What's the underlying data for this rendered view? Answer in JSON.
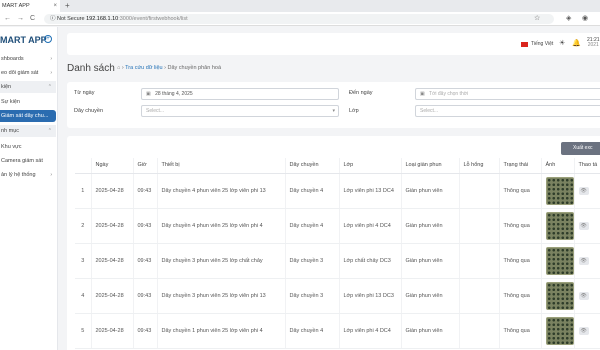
{
  "browser": {
    "tab_title": "MART APP",
    "tab_close": "×",
    "new_tab": "+",
    "back": "←",
    "forward": "→",
    "reload": "C",
    "info": "ⓘ",
    "not_secure": "Not Secure",
    "host": "192.168.1.10",
    "path": ":3000/event/firstwebhook/list",
    "star": "☆"
  },
  "sidebar": {
    "brand": "MART APP",
    "brand_icon": "plus-circle-icon",
    "items": [
      {
        "label": "shboards",
        "chev": "›"
      },
      {
        "label": "eo dõi giám sát",
        "chev": "›"
      },
      {
        "label": "kiện",
        "chev": "⌃"
      },
      {
        "label": "Sự kiện",
        "chev": ""
      },
      {
        "label": "Giám sát dây chu...",
        "chev": ""
      },
      {
        "label": "nh mục",
        "chev": "⌃"
      },
      {
        "label": "Khu vực",
        "chev": ""
      },
      {
        "label": "Camera giám sát",
        "chev": ""
      },
      {
        "label": "ản lý hệ thống",
        "chev": "›"
      }
    ]
  },
  "topbar": {
    "language": "Tiếng Việt",
    "time": "21:21",
    "date": "2021",
    "icons": [
      "sun-icon",
      "bell-icon"
    ]
  },
  "page": {
    "title": "Danh sách",
    "home_icon": "⌂",
    "breadcrumb_sep": "›",
    "breadcrumb_1": "Tra cứu dữ liệu",
    "breadcrumb_2": "Dây chuyền phân hoá"
  },
  "filters": {
    "from_label": "Từ ngày",
    "from_value": "28 tháng 4, 2025",
    "to_label": "Đến ngày",
    "to_placeholder": "Tới đây chọn thời",
    "line_label": "Dây chuyền",
    "line_placeholder": "Select...",
    "layer_label": "Lớp",
    "layer_placeholder": "Select...",
    "calendar_icon": "▣",
    "caret": "▾"
  },
  "table": {
    "export_label": "Xuất exc",
    "headers": [
      "",
      "Ngày",
      "Giờ",
      "Thiết bị",
      "Dây chuyền",
      "Lớp",
      "Loại giàn phun",
      "Lỗ hổng",
      "Trạng thái",
      "Ảnh",
      "Thao tá"
    ],
    "view_btn": "👁",
    "rows": [
      {
        "no": "1",
        "date": "2025-04-28",
        "time": "09:43",
        "device": "Dây chuyền 4 phun viên 25 lớp viên phi 13",
        "line": "Dây chuyền 4",
        "layer": "Lớp viên phi 13 DC4",
        "sprayer": "Giàn phun viên",
        "hole": "",
        "status": "Thông qua"
      },
      {
        "no": "2",
        "date": "2025-04-28",
        "time": "09:43",
        "device": "Dây chuyền 4 phun viên 25 lớp viên phi 4",
        "line": "Dây chuyền 4",
        "layer": "Lớp viên phi 4 DC4",
        "sprayer": "Giàn phun viên",
        "hole": "",
        "status": "Thông qua"
      },
      {
        "no": "3",
        "date": "2025-04-28",
        "time": "09:43",
        "device": "Dây chuyền 3 phun viên 25 lớp chất chảy",
        "line": "Dây chuyền 3",
        "layer": "Lớp chất chảy DC3",
        "sprayer": "Giàn phun viên",
        "hole": "",
        "status": "Thông qua"
      },
      {
        "no": "4",
        "date": "2025-04-28",
        "time": "09:43",
        "device": "Dây chuyền 3 phun viên 25 lớp viên phi 13",
        "line": "Dây chuyền 3",
        "layer": "Lớp viên phi 13 DC3",
        "sprayer": "Giàn phun viên",
        "hole": "",
        "status": "Thông qua"
      },
      {
        "no": "5",
        "date": "2025-04-28",
        "time": "09:43",
        "device": "Dây chuyền 1 phun viên 25 lớp viên phi 4",
        "line": "Dây chuyền 4",
        "layer": "Lớp viên phi 4 DC4",
        "sprayer": "Giàn phun viên",
        "hole": "",
        "status": "Thông qua"
      }
    ]
  }
}
